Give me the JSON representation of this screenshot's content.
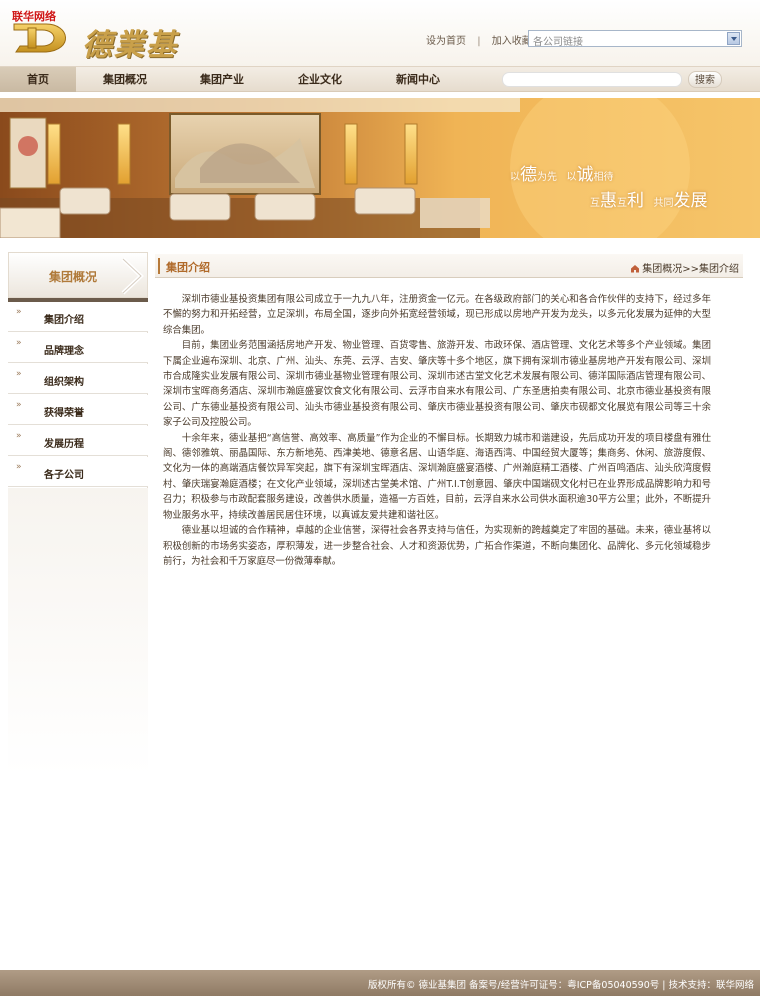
{
  "watermark": "联华网络",
  "header": {
    "logo_text": "德業基",
    "set_home": "设为首页",
    "separator": "|",
    "add_favorite": "加入收藏",
    "company_select": "各公司链接"
  },
  "nav": {
    "items": [
      "首页",
      "集团概况",
      "集团产业",
      "企业文化",
      "新闻中心"
    ],
    "active_index": 0,
    "search_button": "搜索"
  },
  "banner": {
    "slogan_line1": [
      "以",
      "德",
      "为先",
      "以",
      "诚",
      "相待"
    ],
    "slogan_line2": [
      "互",
      "惠",
      "互",
      "利",
      "共同",
      "发展"
    ]
  },
  "sidebar": {
    "title": "集团概况",
    "bullet": "»",
    "items": [
      "集团介绍",
      "品牌理念",
      "组织架构",
      "获得荣誉",
      "发展历程",
      "各子公司"
    ]
  },
  "main": {
    "title": "集团介绍",
    "breadcrumb": "集团概况>>集团介绍",
    "paragraphs": [
      "深圳市德业基投资集团有限公司成立于一九九八年，注册资金一亿元。在各级政府部门的关心和各合作伙伴的支持下，经过多年不懈的努力和开拓经营，立足深圳，布局全国，逐步向外拓宽经营领域，现已形成以房地产开发为龙头，以多元化发展为延伸的大型综合集团。",
      "目前，集团业务范围涵括房地产开发、物业管理、百货零售、旅游开发、市政环保、酒店管理、文化艺术等多个产业领域。集团下属企业遍布深圳、北京、广州、汕头、东莞、云浮、吉安、肇庆等十多个地区，旗下拥有深圳市德业基房地产开发有限公司、深圳市合成隆实业发展有限公司、深圳市德业基物业管理有限公司、深圳市述古堂文化艺术发展有限公司、德洋国际酒店管理有限公司、深圳市宝晖商务酒店、深圳市瀚庭盛宴饮食文化有限公司、云浮市自来水有限公司、广东圣唐拍卖有限公司、北京市德业基投资有限公司、广东德业基投资有限公司、汕头市德业基投资有限公司、肇庆市德业基投资有限公司、肇庆市砚都文化展览有限公司等三十余家子公司及控股公司。",
      "十余年来，德业基把“高信誉、高效率、高质量”作为企业的不懈目标。长期致力城市和谐建设，先后成功开发的项目楼盘有雅仕阁、德邻雅筑、丽晶国际、东方新地苑、西津美地、德意名居、山语华庭、海语西湾、中国经贸大厦等；集商务、休闲、旅游度假、文化为一体的高端酒店餐饮异军突起，旗下有深圳宝晖酒店、深圳瀚庭盛宴酒楼、广州瀚庭精工酒楼、广州百鸣酒店、汕头欣湾度假村、肇庆瑞宴瀚庭酒楼；在文化产业领域，深圳述古堂美术馆、广州T.I.T创意园、肇庆中国端砚文化村已在业界形成品牌影响力和号召力；积极参与市政配套服务建设，改善供水质量，造福一方百姓，目前，云浮自来水公司供水面积逾30平方公里；此外，不断提升物业服务水平，持续改善居民居住环境，以真诚友爱共建和谐社区。",
      "德业基以坦诚的合作精神，卓越的企业信誉，深得社会各界支持与信任，为实现新的跨越奠定了牢固的基础。未来，德业基将以积极创新的市场务实姿态，厚积薄发，进一步整合社会、人才和资源优势，广拓合作渠道，不断向集团化、品牌化、多元化领域稳步前行，为社会和千万家庭尽一份微薄奉献。"
    ]
  },
  "footer": {
    "text": "版权所有© 德业基集团  备案号/经营许可证号：粤ICP备05040590号  |  技术支持：联华网络"
  },
  "colors": {
    "accent": "#b06a2a",
    "footer_bg": "#a08a72",
    "watermark": "#d01818"
  }
}
